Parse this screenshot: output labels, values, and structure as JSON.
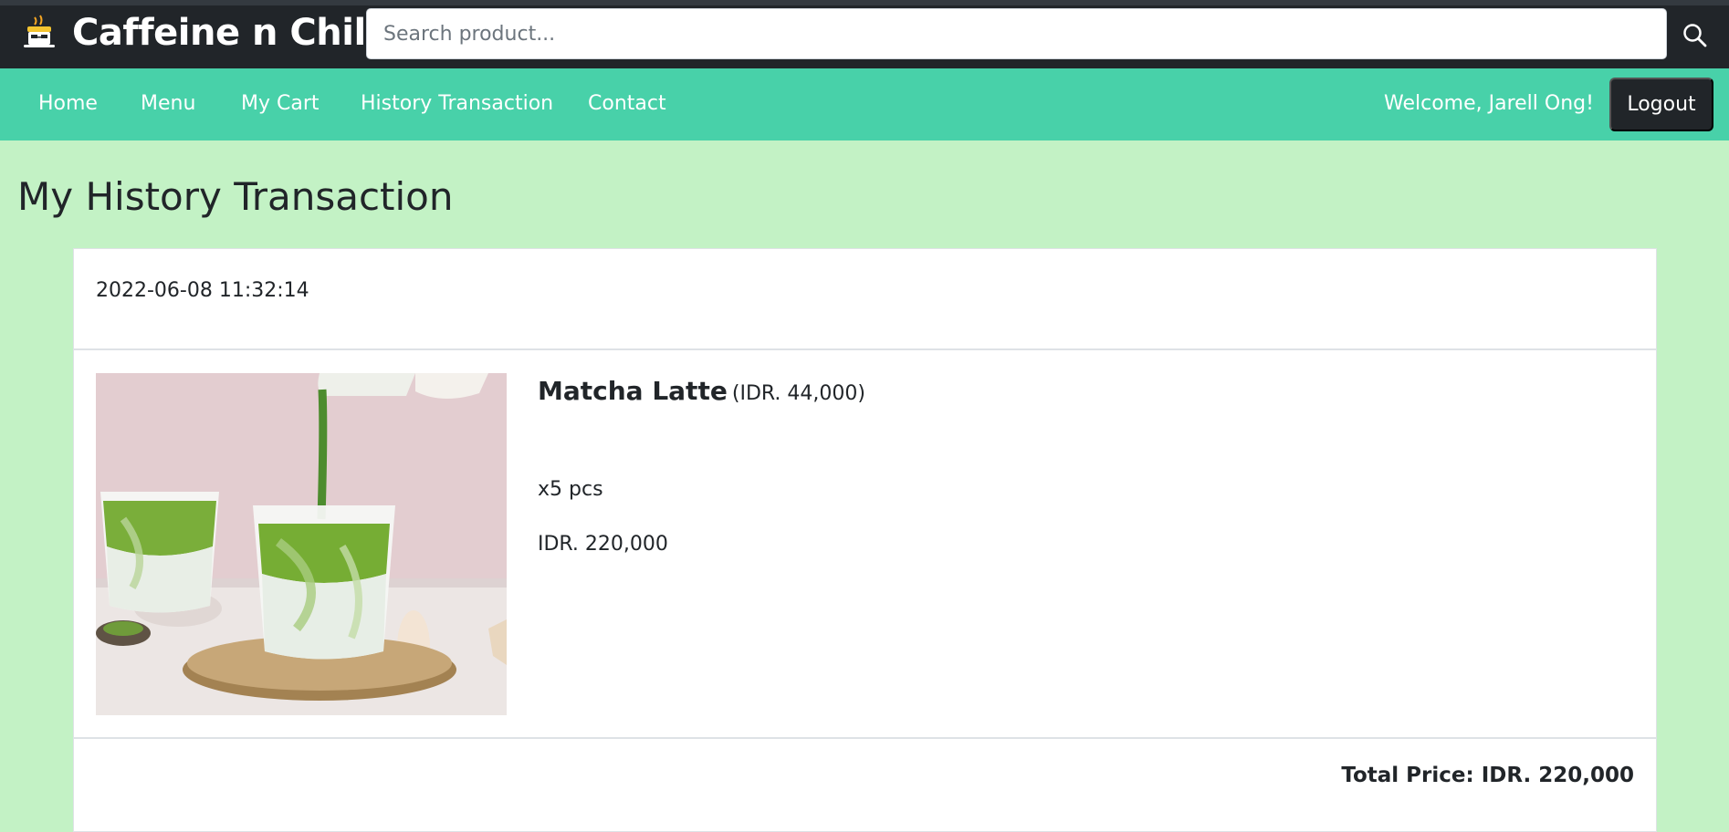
{
  "brand": {
    "name": "Caffeine n Chill",
    "logo_icon": "coffee-cup-icon"
  },
  "search": {
    "placeholder": "Search product...",
    "value": "",
    "icon": "search-icon"
  },
  "nav": {
    "items": [
      {
        "label": "Home"
      },
      {
        "label": "Menu"
      },
      {
        "label": "My Cart"
      },
      {
        "label": "History Transaction"
      },
      {
        "label": "Contact"
      }
    ],
    "welcome": "Welcome, Jarell Ong!",
    "logout_label": "Logout"
  },
  "page": {
    "title": "My History Transaction"
  },
  "transactions": [
    {
      "datetime": "2022-06-08 11:32:14",
      "items": [
        {
          "name": "Matcha Latte",
          "unit_price": "(IDR. 44,000)",
          "quantity": "x5 pcs",
          "subtotal": "IDR. 220,000",
          "image": "matcha-latte-photo"
        }
      ],
      "total": "Total Price: IDR. 220,000"
    }
  ],
  "colors": {
    "topbar": "#212529",
    "navbar": "#48d1a9",
    "page_bg": "#c3f2c5",
    "card_bg": "#ffffff",
    "logout_bg": "#212529"
  }
}
